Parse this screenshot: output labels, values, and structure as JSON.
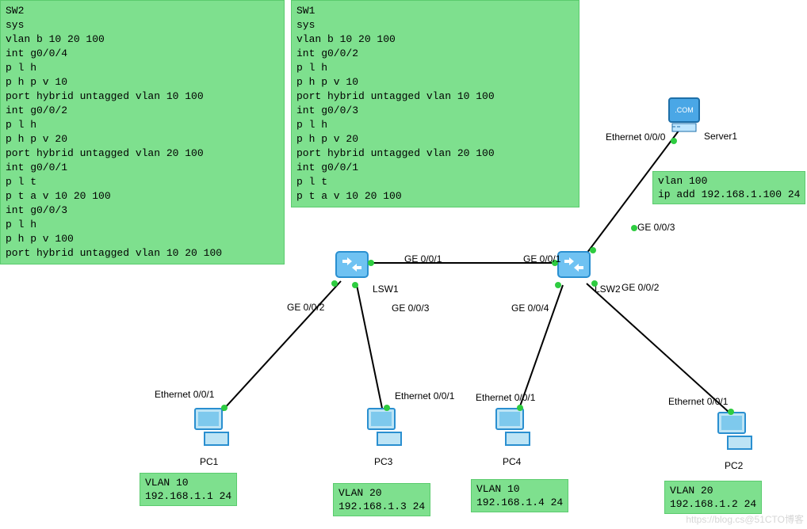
{
  "config_boxes": {
    "sw2": "SW2\nsys\nvlan b 10 20 100\nint g0/0/4\np l h\np h p v 10\nport hybrid untagged vlan 10 100\nint g0/0/2\np l h\np h p v 20\nport hybrid untagged vlan 20 100\nint g0/0/1\np l t\np t a v 10 20 100\nint g0/0/3\np l h\np h p v 100\nport hybrid untagged vlan 10 20 100",
    "sw1": "SW1\nsys\nvlan b 10 20 100\nint g0/0/2\np l h\np h p v 10\nport hybrid untagged vlan 10 100\nint g0/0/3\np l h\np h p v 20\nport hybrid untagged vlan 20 100\nint g0/0/1\np l t\np t a v 10 20 100"
  },
  "notes": {
    "server": "vlan 100\nip add 192.168.1.100 24",
    "pc1": "VLAN 10\n192.168.1.1 24",
    "pc3": "VLAN 20\n192.168.1.3 24",
    "pc4": "VLAN 10\n192.168.1.4 24",
    "pc2": "VLAN 20\n192.168.1.2 24"
  },
  "devices": {
    "lsw1": "LSW1",
    "lsw2": "LSW2",
    "server1": "Server1",
    "pc1": "PC1",
    "pc2": "PC2",
    "pc3": "PC3",
    "pc4": "PC4",
    "server_badge": ".COM"
  },
  "port_labels": {
    "lsw1_g001": "GE 0/0/1",
    "lsw1_g002": "GE 0/0/2",
    "lsw1_g003": "GE 0/0/3",
    "lsw2_g001": "GE 0/0/1",
    "lsw2_g002": "GE 0/0/2",
    "lsw2_g003": "GE 0/0/3",
    "lsw2_g004": "GE 0/0/4",
    "server_eth": "Ethernet 0/0/0",
    "pc1_eth": "Ethernet 0/0/1",
    "pc2_eth": "Ethernet 0/0/1",
    "pc3_eth": "Ethernet 0/0/1",
    "pc4_eth": "Ethernet 0/0/1"
  },
  "watermark": "https://blog.cs@51CTO博客"
}
